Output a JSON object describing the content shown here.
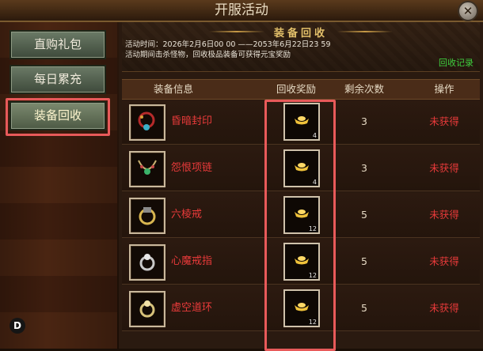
{
  "window": {
    "title": "开服活动",
    "close_label": "✕"
  },
  "sidebar": {
    "items": [
      {
        "label": "直购礼包"
      },
      {
        "label": "每日累充"
      },
      {
        "label": "装备回收"
      }
    ],
    "badge": "D"
  },
  "banner": {
    "title": "装备回收",
    "time_line": "活动时间：2026年2月6日00 00 ——2053年6月22日23 59",
    "desc_line": "活动期间击杀怪物，回收极品装备可获得元宝奖励",
    "record_link": "回收记录"
  },
  "table": {
    "headers": [
      "装备信息",
      "回收奖励",
      "剩余次数",
      "操作"
    ],
    "rows": [
      {
        "icon": "amulet-icon",
        "name": "昏暗封印",
        "reward_icon": "gold-ingot-icon",
        "reward_count": "4",
        "remaining": "3",
        "status": "未获得"
      },
      {
        "icon": "necklace-icon",
        "name": "怨恨项链",
        "reward_icon": "gold-ingot-icon",
        "reward_count": "4",
        "remaining": "3",
        "status": "未获得"
      },
      {
        "icon": "ring-icon",
        "name": "六棱戒",
        "reward_icon": "gold-ingot-icon",
        "reward_count": "12",
        "remaining": "5",
        "status": "未获得"
      },
      {
        "icon": "ring-icon",
        "name": "心魔戒指",
        "reward_icon": "gold-ingot-icon",
        "reward_count": "12",
        "remaining": "5",
        "status": "未获得"
      },
      {
        "icon": "ring-icon",
        "name": "虚空道环",
        "reward_icon": "gold-ingot-icon",
        "reward_count": "12",
        "remaining": "5",
        "status": "未获得"
      }
    ]
  },
  "colors": {
    "item_name": "#e83a3a",
    "status": "#e83a3a",
    "record_link": "#3ecf3e",
    "highlight": "#e85a5a"
  }
}
